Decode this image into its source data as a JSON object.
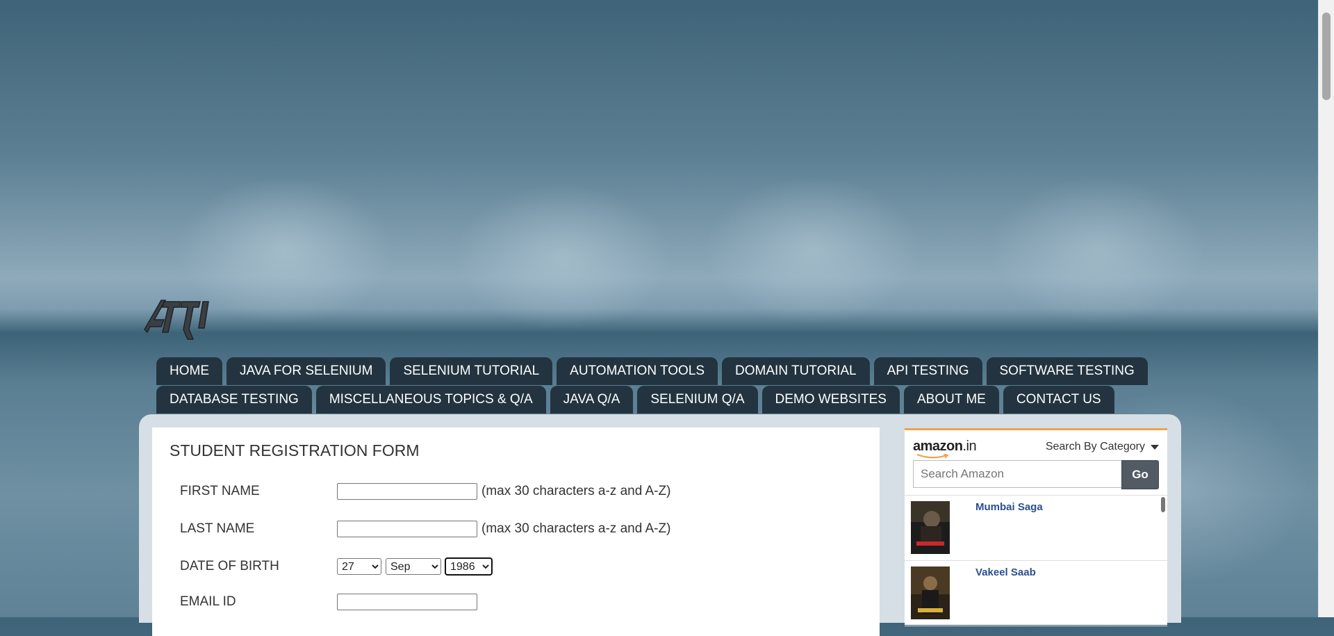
{
  "nav": {
    "row1": [
      "HOME",
      "JAVA FOR SELENIUM",
      "SELENIUM TUTORIAL",
      "AUTOMATION TOOLS",
      "DOMAIN TUTORIAL",
      "API TESTING",
      "SOFTWARE TESTING"
    ],
    "row2": [
      "DATABASE TESTING",
      "MISCELLANEOUS TOPICS & Q/A",
      "JAVA Q/A",
      "SELENIUM Q/A",
      "DEMO WEBSITES",
      "ABOUT ME",
      "CONTACT US"
    ]
  },
  "form": {
    "title": "STUDENT REGISTRATION FORM",
    "first_name_label": "FIRST NAME",
    "first_name_hint": "(max 30 characters a-z and A-Z)",
    "last_name_label": "LAST NAME",
    "last_name_hint": "(max 30 characters a-z and A-Z)",
    "dob_label": "DATE OF BIRTH",
    "dob_day": "27",
    "dob_month": "Sep",
    "dob_year": "1986",
    "email_label": "EMAIL ID"
  },
  "amazon": {
    "logo_text": "amazon",
    "logo_tld": ".in",
    "category_label": "Search By Category",
    "search_placeholder": "Search Amazon",
    "go_label": "Go",
    "items": [
      {
        "title": "Mumbai Saga"
      },
      {
        "title": "Vakeel Saab"
      }
    ]
  },
  "colors": {
    "nav_bg": "#233440",
    "amazon_accent": "#f0a14a",
    "link_blue": "#2b4f8c"
  }
}
